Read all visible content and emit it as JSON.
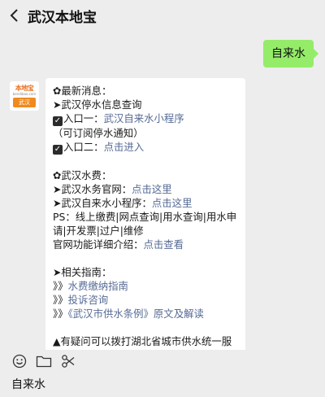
{
  "header": {
    "back_icon": "chevron-left-icon",
    "title": "武汉本地宝"
  },
  "sent_message": "自来水",
  "avatar": {
    "brand": "本地宝",
    "sub": "bendibao.com",
    "badge": "武汉"
  },
  "reply": {
    "l1": "✿最新消息：",
    "l2": "➤武汉停水信息查询",
    "l3_pre": "入口一：",
    "l3_link": "武汉自来水小程序",
    "l4": "（可订阅停水通知）",
    "l5_pre": "入口二：",
    "l5_link": "点击进入",
    "l6": "✿武汉水费：",
    "l7_pre": "➤武汉水务官网：",
    "l7_link": "点击这里",
    "l8_pre": "➤武汉自来水小程序：",
    "l8_link": "点击这里",
    "l9": "PS：线上缴费|网点查询|用水查询|用水申请|开发票|过户|维修",
    "l10_pre": "官网功能详细介绍：",
    "l10_link": "点击查看",
    "l11": "➤相关指南：",
    "l12_pre": "》》",
    "l12_link": "水费缴纳指南",
    "l13_pre": "》》",
    "l13_link": "投诉咨询",
    "l14_pre": "》》",
    "l14_link": "《武汉市供水条例》原文及解读",
    "l15": "▲有疑问可以拨打湖北省城市供水统一服"
  },
  "toolbar": {
    "icons": [
      "emoji-icon",
      "folder-icon",
      "scissors-icon"
    ]
  },
  "input": {
    "value": "自来水"
  }
}
